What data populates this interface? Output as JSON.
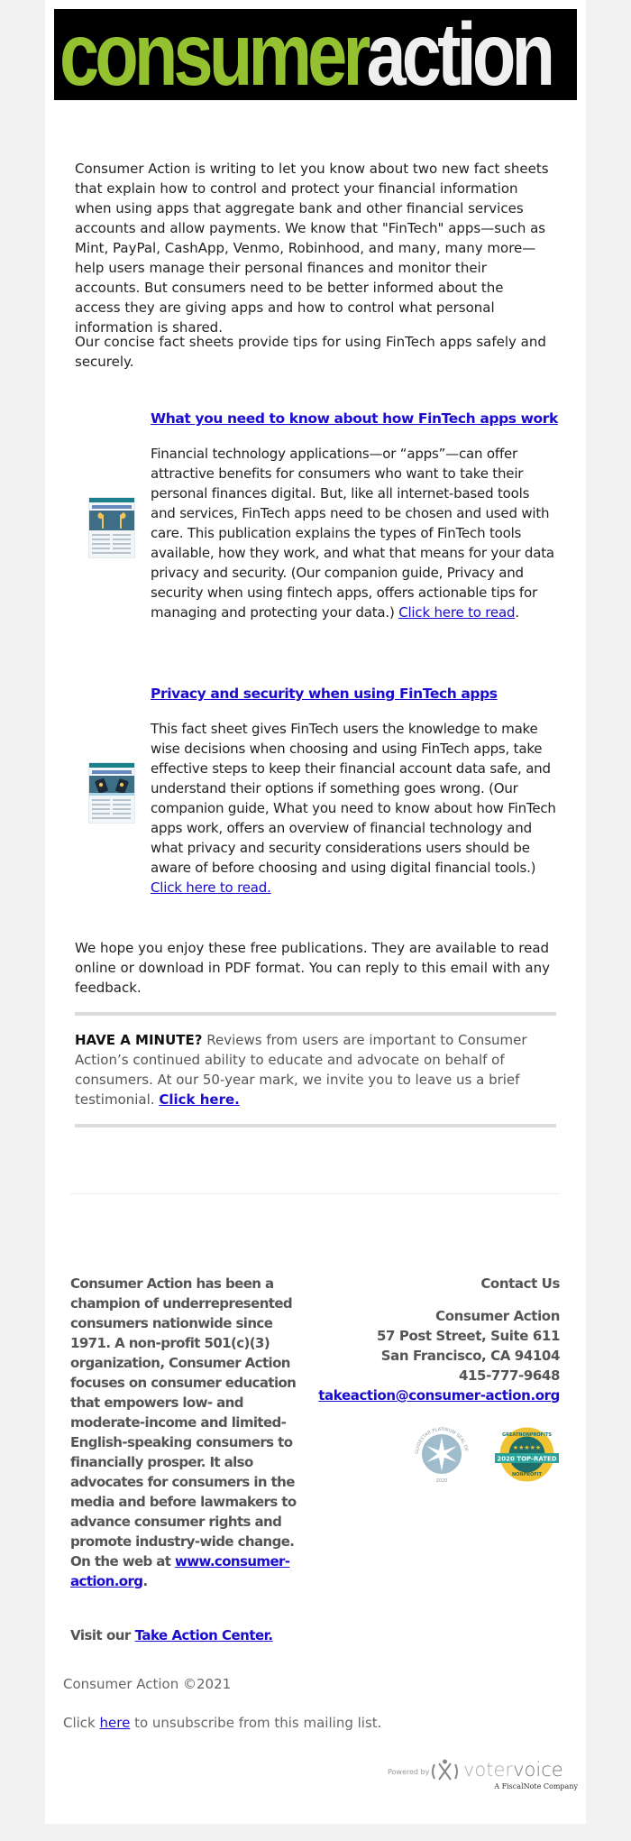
{
  "header": {
    "logo_part1": "consumer",
    "logo_part2": "action",
    "brand_green": "#94c12f"
  },
  "intro": {
    "paragraph1": "Consumer Action is writing to let you know about two new fact sheets that explain how to control and protect your financial information when using apps that aggregate bank and other financial services accounts and allow payments. We know that \"FinTech\" apps—such as Mint, PayPal, CashApp, Venmo, Robinhood, and many, many more—help users manage their personal finances and monitor their accounts. But consumers need to be better informed about the access they are giving apps and how to control what personal information is shared.",
    "paragraph2": "Our concise fact sheets provide tips for using FinTech apps safely and securely."
  },
  "fact_sheets": [
    {
      "title": "What you need to know about how FinTech apps work",
      "description": "Financial technology applications—or “apps”—can offer attractive benefits for consumers who want to take their personal finances digital. But, like all internet-based tools and services, FinTech apps need to be chosen and used with care. This publication explains the types of FinTech tools available, how they work, and what that means for your data privacy and security. (Our companion guide, Privacy and security when using fintech apps, offers actionable tips for managing and protecting your data.) ",
      "link_label": "Click here to read",
      "after_link": "."
    },
    {
      "title": "Privacy and security when using FinTech apps",
      "description": "This fact sheet gives FinTech users the knowledge to make wise decisions when choosing and using FinTech apps, take effective steps to keep their financial account data safe, and understand their options if something goes wrong. (Our companion guide, What you need to know about how FinTech apps work, offers an overview of financial technology and what privacy and security considerations users should be aware of before choosing and using digital financial tools.) ",
      "link_label": "Click here to read.",
      "after_link": ""
    }
  ],
  "closing": {
    "paragraph": "We hope you enjoy these free publications. They are available to read online or download in PDF format. You can reply to this email with any feedback."
  },
  "minute": {
    "heading": "HAVE A MINUTE?",
    "text": " Reviews from users are important to Consumer Action’s continued ability to educate and advocate on behalf of consumers. At our 50-year mark, we invite you to leave us a brief testimonial. ",
    "link_label": "Click here."
  },
  "footer": {
    "about": "Consumer Action has been a champion of underrepresented consumers nationwide since 1971. A non-profit 501(c)(3) organization, Consumer Action focuses on consumer education that empowers low- and moderate-income and limited-English-speaking consumers to financially prosper. It also advocates for consumers in the media and before lawmakers to advance consumer rights and promote industry-wide change. On the web at ",
    "website_link": "www.consumer-action.org",
    "about_end": ".",
    "contact": {
      "title": "Contact Us",
      "org": "Consumer Action",
      "address1": "57 Post Street, Suite 611",
      "address2": "San Francisco, CA 94104",
      "phone": "415-777-9648",
      "email": "takeaction@consumer-action.org"
    },
    "badges": {
      "guidestar": "GUIDESTAR PLATINUM SEAL OF TRANSPARENCY",
      "guidestar_year": "2020",
      "greatnonprofits_top": "GREATNONPROFITS",
      "greatnonprofits_ribbon": "2020 TOP-RATED",
      "greatnonprofits_bottom": "NONPROFIT"
    },
    "visit_prefix": "Visit our ",
    "visit_link": "Take Action Center.",
    "copyright": "Consumer Action ©2021",
    "unsubscribe_prefix": "Click ",
    "unsubscribe_link": "here",
    "unsubscribe_suffix": " to unsubscribe from this mailing list.",
    "powered_by": "Powered by",
    "powered_brand_1": "voter",
    "powered_brand_2": "voice",
    "powered_tagline": "A FiscalNote Company"
  }
}
